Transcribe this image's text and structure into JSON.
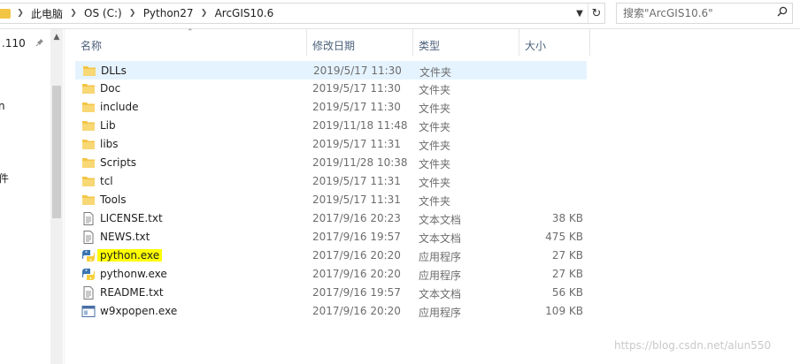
{
  "address": {
    "crumbs": [
      "此电脑",
      "OS (C:)",
      "Python27",
      "ArcGIS10.6"
    ],
    "search_placeholder": "搜索\"ArcGIS10.6\""
  },
  "nav": {
    "items": [
      ".110",
      "n",
      "件"
    ]
  },
  "columns": {
    "name": "名称",
    "date": "修改日期",
    "type": "类型",
    "size": "大小"
  },
  "files": [
    {
      "name": "DLLs",
      "date": "2019/5/17 11:30",
      "type": "文件夹",
      "size": "",
      "icon": "folder-icon",
      "selected": true
    },
    {
      "name": "Doc",
      "date": "2019/5/17 11:30",
      "type": "文件夹",
      "size": "",
      "icon": "folder-icon"
    },
    {
      "name": "include",
      "date": "2019/5/17 11:30",
      "type": "文件夹",
      "size": "",
      "icon": "folder-icon"
    },
    {
      "name": "Lib",
      "date": "2019/11/18 11:48",
      "type": "文件夹",
      "size": "",
      "icon": "folder-icon"
    },
    {
      "name": "libs",
      "date": "2019/5/17 11:31",
      "type": "文件夹",
      "size": "",
      "icon": "folder-icon"
    },
    {
      "name": "Scripts",
      "date": "2019/11/28 10:38",
      "type": "文件夹",
      "size": "",
      "icon": "folder-icon"
    },
    {
      "name": "tcl",
      "date": "2019/5/17 11:31",
      "type": "文件夹",
      "size": "",
      "icon": "folder-icon"
    },
    {
      "name": "Tools",
      "date": "2019/5/17 11:31",
      "type": "文件夹",
      "size": "",
      "icon": "folder-icon"
    },
    {
      "name": "LICENSE.txt",
      "date": "2017/9/16 20:23",
      "type": "文本文档",
      "size": "38 KB",
      "icon": "text-file-icon"
    },
    {
      "name": "NEWS.txt",
      "date": "2017/9/16 19:57",
      "type": "文本文档",
      "size": "475 KB",
      "icon": "text-file-icon"
    },
    {
      "name": "python.exe",
      "date": "2017/9/16 20:20",
      "type": "应用程序",
      "size": "27 KB",
      "icon": "python-icon",
      "highlight": true
    },
    {
      "name": "pythonw.exe",
      "date": "2017/9/16 20:20",
      "type": "应用程序",
      "size": "27 KB",
      "icon": "python-icon"
    },
    {
      "name": "README.txt",
      "date": "2017/9/16 19:57",
      "type": "文本文档",
      "size": "56 KB",
      "icon": "text-file-icon"
    },
    {
      "name": "w9xpopen.exe",
      "date": "2017/9/16 20:20",
      "type": "应用程序",
      "size": "109 KB",
      "icon": "app-window-icon"
    }
  ],
  "watermark": "https://blog.csdn.net/alun550",
  "colors": {
    "folder": "#f3c545",
    "selection": "#e5f3ff",
    "highlight": "#ffff00",
    "header_text": "#4c607a",
    "detail_text": "#6d6d6d"
  }
}
